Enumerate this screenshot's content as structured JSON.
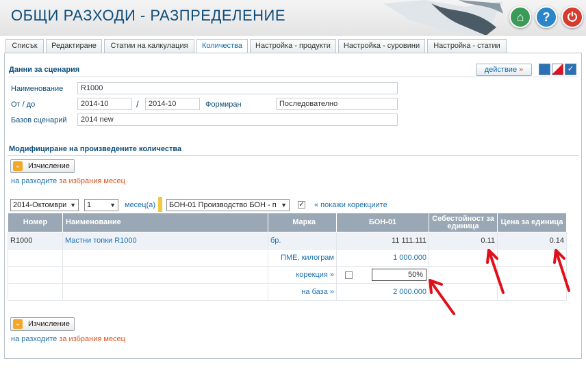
{
  "header": {
    "title": "ОБЩИ РАЗХОДИ - РАЗПРЕДЕЛЕНИЕ"
  },
  "tabs": [
    {
      "label": "Списък"
    },
    {
      "label": "Редактиране"
    },
    {
      "label": "Статии на калкулация"
    },
    {
      "label": "Количества"
    },
    {
      "label": "Настройка - продукти"
    },
    {
      "label": "Настройка - суровини"
    },
    {
      "label": "Настройка - статии"
    }
  ],
  "scenario": {
    "section_title": "Данни за сценария",
    "action_label": "действие",
    "name_label": "Наименование",
    "name_value": "R1000",
    "from_to_label": "От / до",
    "from_value": "2014-10",
    "to_value": "2014-10",
    "formed_label": "Формиран",
    "formed_value": "Последователно",
    "base_label": "Базов сценарий",
    "base_value": "2014 new"
  },
  "modify": {
    "section_title": "Модифициране на произведените количества",
    "calc_label": "Изчисление",
    "note_prefix": "на разходите",
    "note_suffix": "за избрания месец"
  },
  "filters": {
    "month_value": "2014-Октомври",
    "count_value": "1",
    "months_label": "месец(а)",
    "prod_value": "БОН-01 Производство БОН - п",
    "show_corr_label": "« покажи корекциите"
  },
  "table": {
    "headers": [
      "Номер",
      "Наименование",
      "Марка",
      "БОН-01",
      "Себестойност за единица",
      "Цена за единица"
    ],
    "row": {
      "number": "R1000",
      "name": "Мастни топки R1000",
      "mark": "бр.",
      "bon": "11 111.111",
      "cost": "0.11",
      "price": "0.14"
    },
    "pme_label": "ПМЕ, килограм",
    "pme_value": "1 000.000",
    "corr_label": "корекция »",
    "corr_value": "50%",
    "base_label": "на база »",
    "base_value": "2 000.000"
  },
  "colors": {
    "title": "#0e4d7a",
    "accent": "#1a6fb0",
    "orange": "#d9531e",
    "header_grey": "#9aa8b5",
    "home_btn": "#3a9a57",
    "help_btn": "#2a86c8",
    "power_btn": "#d63b2e",
    "arrow": "#e0101a"
  }
}
